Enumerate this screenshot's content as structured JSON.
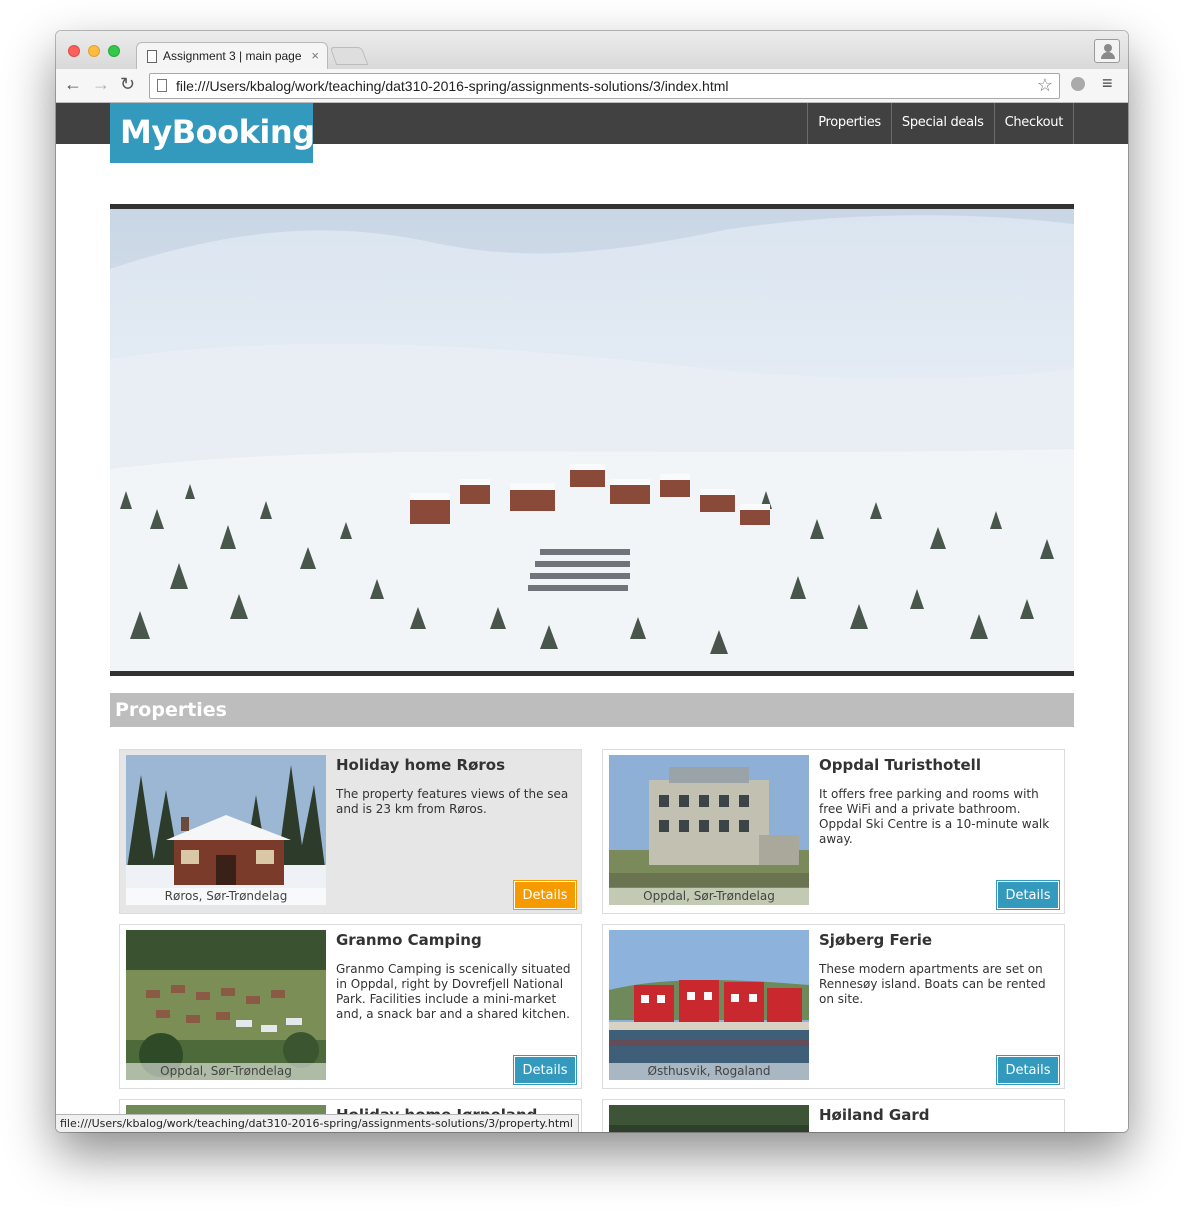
{
  "browser": {
    "tab_title": "Assignment 3 | main page",
    "tab_close": "×",
    "url": "file:///Users/kbalog/work/teaching/dat310-2016-spring/assignments-solutions/3/index.html",
    "status_url": "file:///Users/kbalog/work/teaching/dat310-2016-spring/assignments-solutions/3/property.html",
    "back_glyph": "←",
    "forward_glyph": "→",
    "reload_glyph": "↻",
    "star_glyph": "☆",
    "menu_glyph": "≡"
  },
  "site": {
    "logo": "MyBooking",
    "nav": [
      "Properties",
      "Special deals",
      "Checkout"
    ],
    "section_title": "Properties",
    "brand_color": "#3399bd",
    "hover_color": "#f59b00"
  },
  "properties": [
    {
      "title": "Holiday home Røros",
      "description": "The property features views of the sea and is 23 km from Røros.",
      "location": "Røros, Sør-Trøndelag",
      "button": "Details",
      "hovered": true,
      "photo_icon": "cabin-photo"
    },
    {
      "title": "Oppdal Turisthotell",
      "description": "It offers free parking and rooms with free WiFi and a private bathroom. Oppdal Ski Centre is a 10-minute walk away.",
      "location": "Oppdal, Sør-Trøndelag",
      "button": "Details",
      "hovered": false,
      "photo_icon": "hotel-photo"
    },
    {
      "title": "Granmo Camping",
      "description": "Granmo Camping is scenically situated in Oppdal, right by Dovrefjell National Park. Facilities include a mini-market and, a snack bar and a shared kitchen.",
      "location": "Oppdal, Sør-Trøndelag",
      "button": "Details",
      "hovered": false,
      "photo_icon": "camping-photo"
    },
    {
      "title": "Sjøberg Ferie",
      "description": "These modern apartments are set on Rennesøy island. Boats can be rented on site.",
      "location": "Østhusvik, Rogaland",
      "button": "Details",
      "hovered": false,
      "photo_icon": "harbour-photo"
    },
    {
      "title": "Holiday home Jørpeland",
      "description": "",
      "location": "",
      "button": "",
      "hovered": false,
      "photo_icon": "forest-photo"
    },
    {
      "title": "Høiland Gard",
      "description": "",
      "location": "",
      "button": "",
      "hovered": false,
      "photo_icon": "farm-photo"
    }
  ]
}
